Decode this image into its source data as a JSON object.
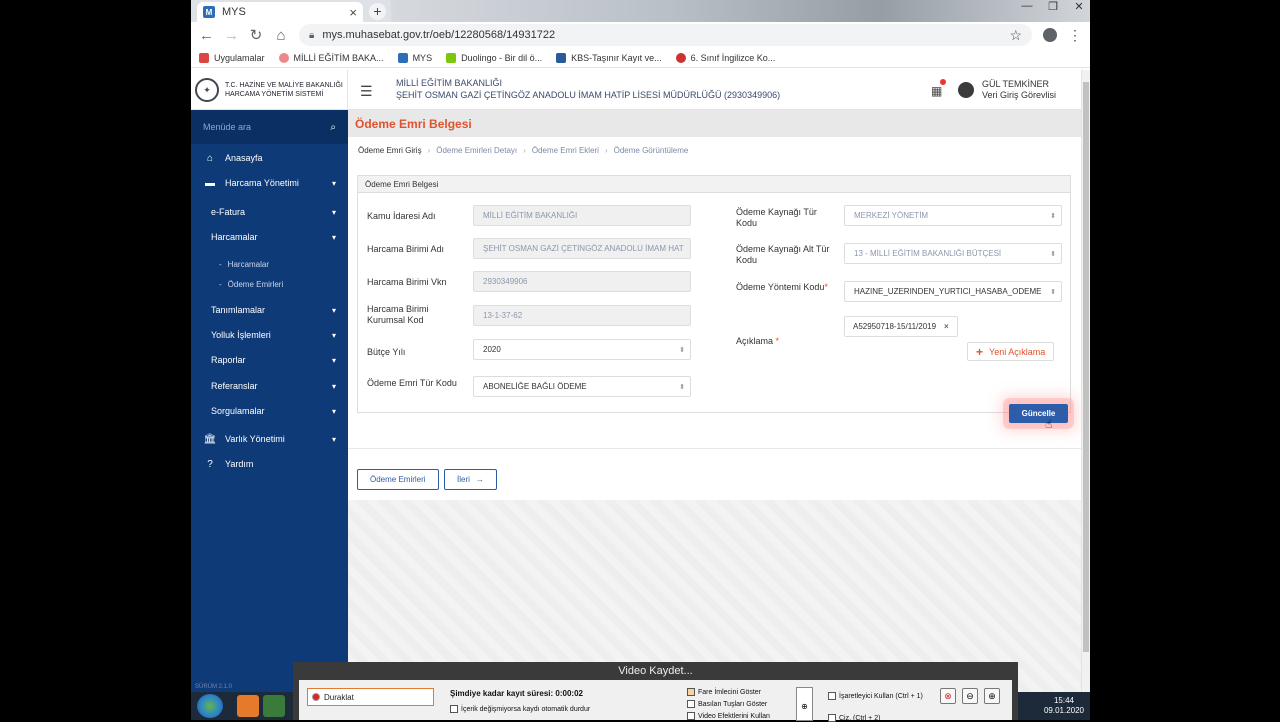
{
  "browser": {
    "tab_title": "MYS",
    "tab_icon_text": "M",
    "url": "mys.muhasebat.gov.tr/oeb/12280568/14931722",
    "bookmarks": [
      {
        "label": "Uygulamalar",
        "color": "#d44"
      },
      {
        "label": "MİLLİ EĞİTİM BAKA...",
        "color": "#e88"
      },
      {
        "label": "MYS",
        "color": "#2d6fb7"
      },
      {
        "label": "Duolingo - Bir dil ö...",
        "color": "#7ac70c"
      },
      {
        "label": "KBS-Taşınır Kayıt ve...",
        "color": "#2a5a9a"
      },
      {
        "label": "6. Sınıf İngilizce Ko...",
        "color": "#c33"
      }
    ]
  },
  "header": {
    "logo_line1": "T.C. HAZİNE VE MALİYE BAKANLIĞI",
    "logo_line2": "HARCAMA YÖNETİM SİSTEMİ",
    "org_line1": "MİLLİ EĞİTİM BAKANLIĞI",
    "org_line2": "ŞEHİT OSMAN GAZİ ÇETİNGÖZ ANADOLU İMAM HATİP LİSESİ MÜDÜRLÜĞÜ (2930349906)",
    "user_name": "GÜL TEMKİNER",
    "user_role": "Veri Giriş Görevlisi"
  },
  "sidebar": {
    "search_placeholder": "Menüde ara",
    "items": [
      {
        "label": "Anasayfa"
      },
      {
        "label": "Harcama Yönetimi"
      },
      {
        "label": "e-Fatura"
      },
      {
        "label": "Harcamalar"
      },
      {
        "label": "Harcamalar"
      },
      {
        "label": "Ödeme Emirleri"
      },
      {
        "label": "Tanımlamalar"
      },
      {
        "label": "Yolluk İşlemleri"
      },
      {
        "label": "Raporlar"
      },
      {
        "label": "Referanslar"
      },
      {
        "label": "Sorgulamalar"
      },
      {
        "label": "Varlık Yönetimi"
      },
      {
        "label": "Yardım"
      }
    ],
    "version": "SÜRÜM 2.1.0"
  },
  "page": {
    "title": "Ödeme Emri Belgesi",
    "breadcrumbs": [
      "Ödeme Emri Giriş",
      "Ödeme Emirleri Detayı",
      "Ödeme Emri Ekleri",
      "Ödeme Görüntüleme"
    ],
    "box_title": "Ödeme Emri Belgesi"
  },
  "form": {
    "kamu_idaresi_label": "Kamu İdaresi Adı",
    "kamu_idaresi_value": "MİLLİ EĞİTİM BAKANLIĞI",
    "harcama_birimi_label": "Harcama Birimi Adı",
    "harcama_birimi_value": "ŞEHİT OSMAN GAZİ ÇETİNGÖZ ANADOLU İMAM HAT",
    "vkn_label": "Harcama Birimi Vkn",
    "vkn_value": "2930349906",
    "kurumsal_kod_label": "Harcama Birimi Kurumsal Kod",
    "kurumsal_kod_value": "13-1-37-62",
    "butce_yili_label": "Bütçe Yılı",
    "butce_yili_value": "2020",
    "tur_kodu_label": "Ödeme Emri Tür Kodu",
    "tur_kodu_value": "ABONELİĞE BAĞLI ÖDEME",
    "kaynak_tur_label": "Ödeme Kaynağı Tür Kodu",
    "kaynak_tur_value": "MERKEZİ YÖNETİM",
    "kaynak_alt_label": "Ödeme Kaynağı Alt Tür Kodu",
    "kaynak_alt_value": "13 - MİLLİ EĞİTİM BAKANLIĞI BÜTÇESİ",
    "yontem_label": "Ödeme Yöntemi Kodu",
    "yontem_value": "HAZINE_UZERINDEN_YURTICI_HASABA_ODEME",
    "aciklama_label": "Açıklama",
    "aciklama_tag": "A52950718-15/11/2019",
    "yeni_aciklama": "Yeni Açıklama",
    "required_mark": "*"
  },
  "actions": {
    "guncelle": "Güncelle",
    "odeme_emirleri": "Ödeme Emirleri",
    "ileri": "İleri"
  },
  "recorder": {
    "title": "Video Kaydet...",
    "pause": "Duraklat",
    "elapsed": "Şimdiye kadar kayıt süresi: 0:00:02",
    "auto_stop": "İçerik değişmiyorsa kaydı otomatik durdur",
    "show_cursor": "Fare İmlecini Göster",
    "show_keys": "Basılan Tuşları Göster",
    "video_effects": "Video Efektlerini Kullan",
    "use_marker": "İşaretleyici Kullan (Ctrl + 1)",
    "extra": "Ciz. (Ctrl + 2)"
  },
  "taskbar": {
    "time": "15:44",
    "date": "09.01.2020"
  }
}
